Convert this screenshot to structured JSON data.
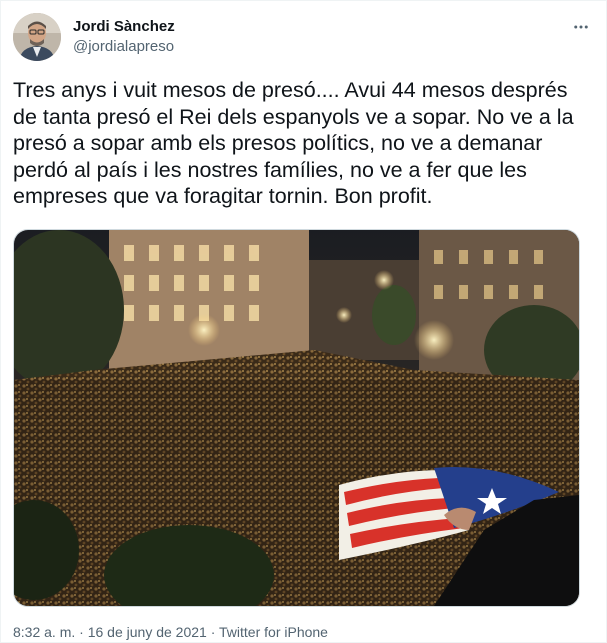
{
  "author": {
    "name": "Jordi Sànchez",
    "handle": "@jordialapreso"
  },
  "tweet": {
    "text": "Tres anys i vuit mesos de presó.... Avui 44 mesos després de tanta presó el Rei dels espanyols ve a sopar. No ve a la presó a sopar amb els presos polítics, no ve a demanar perdó al país i les nostres famílies, no ve a fer que les empreses que va foragitar tornin. Bon profit."
  },
  "meta": {
    "time": "8:32 a. m.",
    "separator": "·",
    "date": "16 de juny de 2021",
    "source": "Twitter for iPhone"
  },
  "icons": {
    "more": "more-dots-icon"
  },
  "colors": {
    "secondary_text": "#536471",
    "primary_text": "#0f1419",
    "border": "#cfd9de"
  }
}
